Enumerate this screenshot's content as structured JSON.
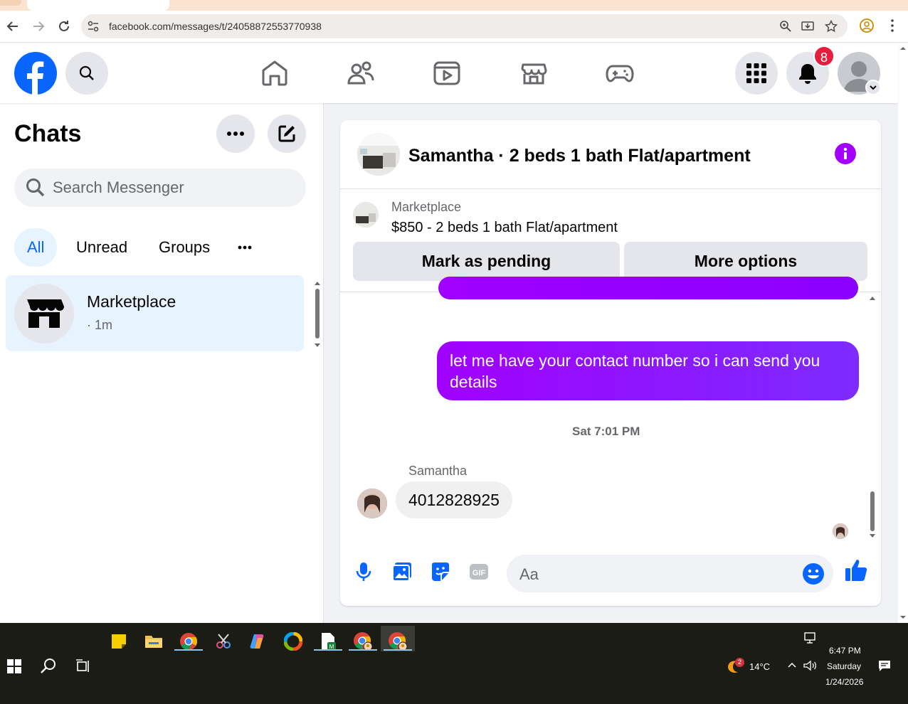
{
  "browser": {
    "url": "facebook.com/messages/t/24058872553770938"
  },
  "fbnav": {
    "notifications_count": "8",
    "icons": [
      "home-icon",
      "friends-icon",
      "video-icon",
      "marketplace-icon",
      "gaming-icon"
    ]
  },
  "left": {
    "title": "Chats",
    "search_placeholder": "Search Messenger",
    "filters": [
      "All",
      "Unread",
      "Groups"
    ],
    "chat": {
      "name": "Marketplace",
      "time": "· 1m"
    }
  },
  "conversation": {
    "title": "Samantha · 2 beds 1 bath Flat/apartment",
    "marketplace_label": "Marketplace",
    "listing": "$850 - 2 beds 1 bath Flat/apartment",
    "mark_pending": "Mark as pending",
    "more_options": "More options",
    "outgoing_message": "let me have your contact number so i can send you details",
    "timestamp": "Sat 7:01 PM",
    "sender_name": "Samantha",
    "incoming_message": "4012828925",
    "composer_placeholder": "Aa"
  },
  "taskbar": {
    "weather_badge": "2",
    "temperature": "14°C",
    "time": "6:47 PM",
    "day": "Saturday",
    "date": "1/24/2026"
  },
  "colors": {
    "fb_blue": "#0866ff",
    "messenger_purple": "#a100ff",
    "notification_red": "#e41e3f"
  }
}
